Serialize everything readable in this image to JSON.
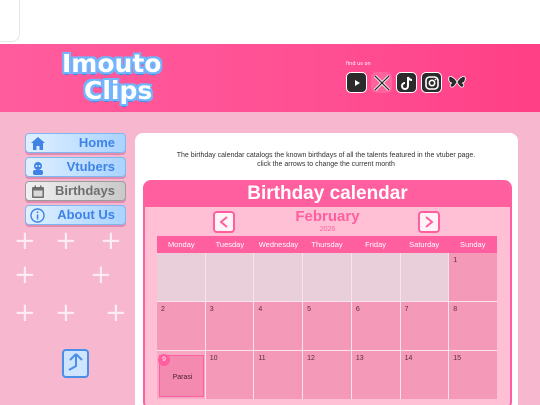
{
  "brand": {
    "logo_line1": "Imouto",
    "logo_line2": "Clips"
  },
  "header": {
    "find_us": "find us on",
    "socials": [
      {
        "name": "youtube-icon"
      },
      {
        "name": "x-icon"
      },
      {
        "name": "tiktok-icon"
      },
      {
        "name": "instagram-icon"
      },
      {
        "name": "bluesky-icon"
      }
    ]
  },
  "nav": {
    "items": [
      {
        "label": "Home",
        "icon": "home-icon"
      },
      {
        "label": "Vtubers",
        "icon": "person-icon"
      },
      {
        "label": "Birthdays",
        "icon": "calendar-icon"
      },
      {
        "label": "About Us",
        "icon": "info-icon"
      }
    ]
  },
  "intro": "The birthday calendar catalogs the known birthdays of all the talents featured in the vtuber page. click the arrows to change the current month",
  "calendar": {
    "title": "Birthday calendar",
    "month": "February",
    "year": "2026",
    "weekdays": [
      "Monday",
      "Tuesday",
      "Wednesday",
      "Thursday",
      "Friday",
      "Saturday",
      "Sunday"
    ],
    "rows": [
      [
        null,
        null,
        null,
        null,
        null,
        null,
        "1"
      ],
      [
        "2",
        "3",
        "4",
        "5",
        "6",
        "7",
        "8"
      ],
      [
        "9",
        "10",
        "11",
        "12",
        "13",
        "14",
        "15"
      ]
    ],
    "birthday": {
      "day": "9",
      "name": "Parasi"
    }
  },
  "colors": {
    "header_pink": "#ff4f93",
    "accent_pink": "#ff5f9f",
    "nav_blue": "#3f83e6",
    "background": "#f7b8cf"
  }
}
